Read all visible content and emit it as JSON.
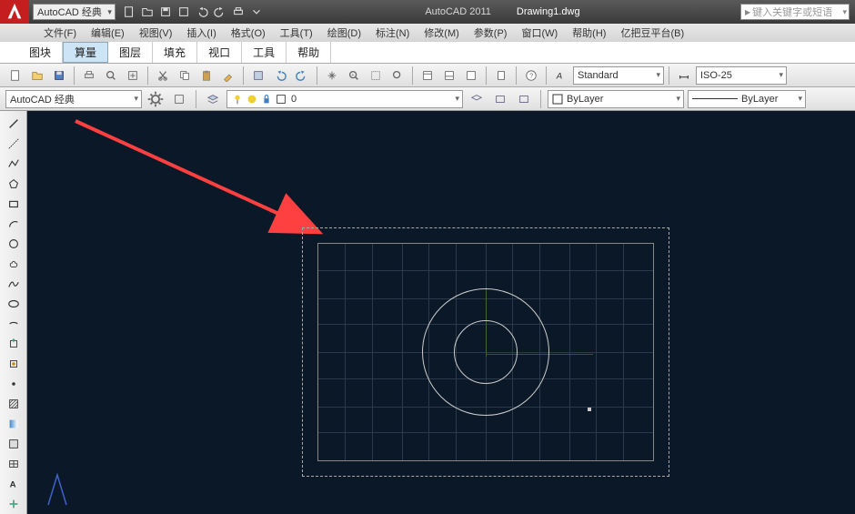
{
  "title": {
    "workspace": "AutoCAD 经典",
    "app": "AutoCAD 2011",
    "doc": "Drawing1.dwg",
    "search_placeholder": "键入关键字或短语"
  },
  "menubar": [
    "文件(F)",
    "编辑(E)",
    "视图(V)",
    "插入(I)",
    "格式(O)",
    "工具(T)",
    "绘图(D)",
    "标注(N)",
    "修改(M)",
    "参数(P)",
    "窗口(W)",
    "帮助(H)",
    "亿把豆平台(B)"
  ],
  "tabs": [
    {
      "label": "图块",
      "active": false
    },
    {
      "label": "算量",
      "active": true
    },
    {
      "label": "图层",
      "active": false
    },
    {
      "label": "填充",
      "active": false
    },
    {
      "label": "视口",
      "active": false
    },
    {
      "label": "工具",
      "active": false
    },
    {
      "label": "帮助",
      "active": false
    }
  ],
  "row2": {
    "workspace": "AutoCAD 经典",
    "layer_value": "0",
    "color_value": "ByLayer",
    "line_value": "ByLayer",
    "textstyle": "Standard",
    "dimstyle": "ISO-25"
  }
}
